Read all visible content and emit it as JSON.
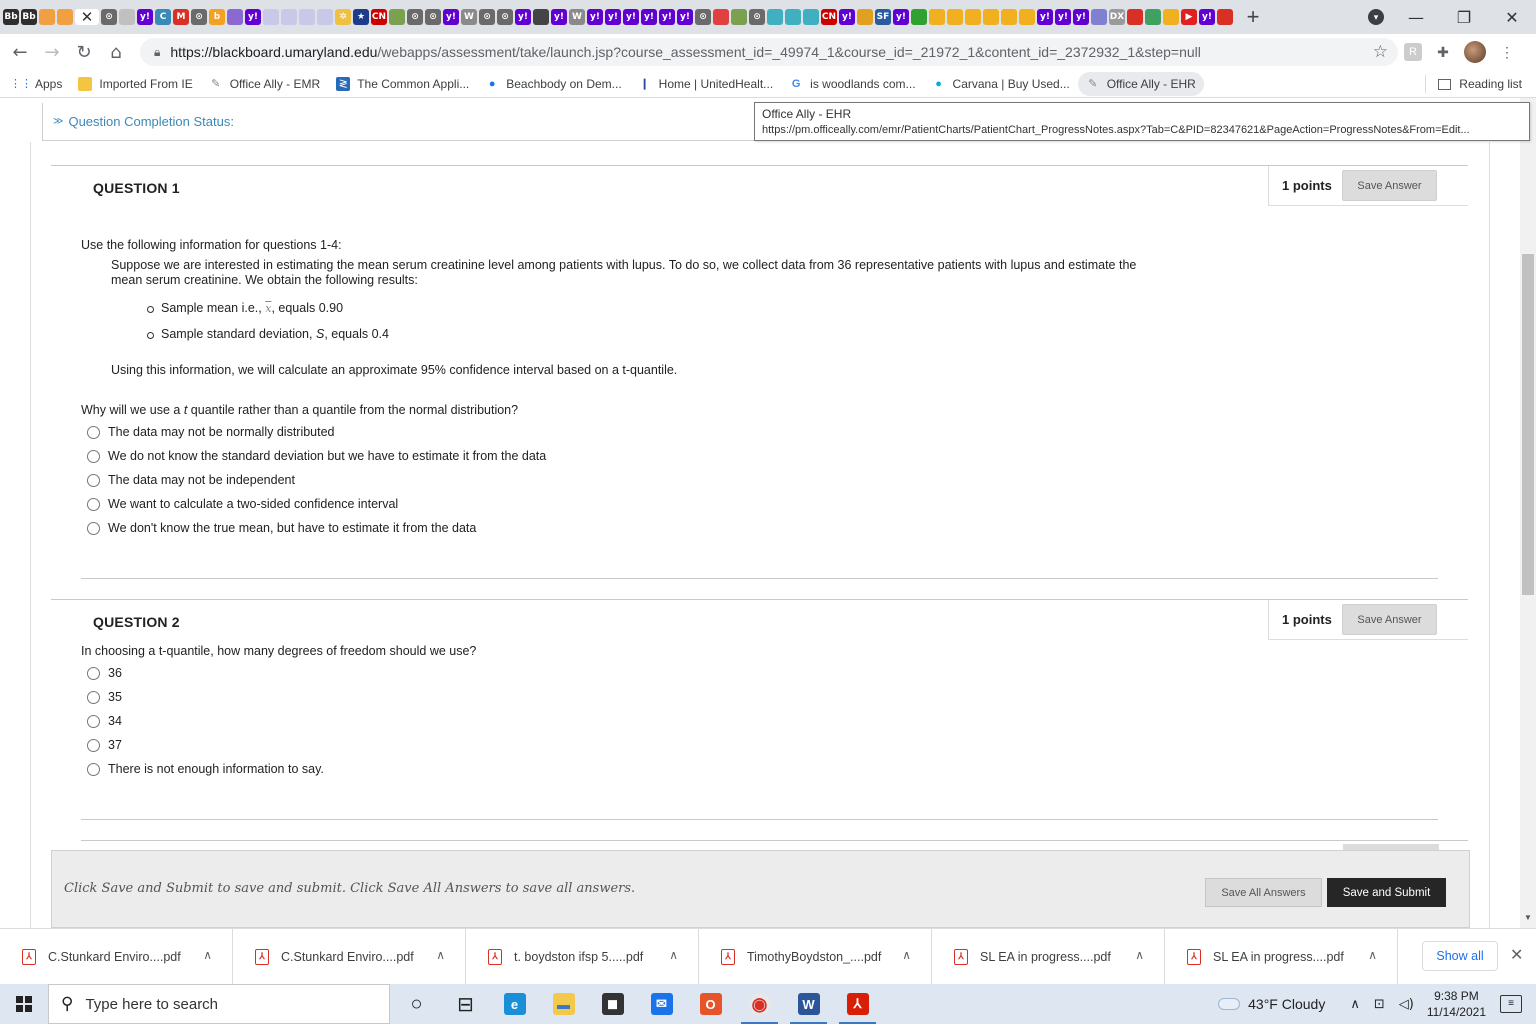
{
  "browser": {
    "url_host": "https://blackboard.umaryland.edu",
    "url_path": "/webapps/assessment/take/launch.jsp?course_assessment_id=_49974_1&course_id=_21972_1&content_id=_2372932_1&step=null",
    "new_tab_label": "+",
    "window_controls": {
      "minimize": "—",
      "restore": "❐",
      "close": "✕"
    },
    "tab_favicons": [
      {
        "label": "Bb",
        "color": "#2e2e2e"
      },
      {
        "label": "Bb",
        "color": "#2e2e2e"
      },
      {
        "label": "",
        "color": "#f0a040"
      },
      {
        "label": "",
        "color": "#f0a040"
      },
      {
        "label": "✕",
        "color": "#ffffff",
        "active": true
      },
      {
        "label": "⊙",
        "color": "#6a6a6a"
      },
      {
        "label": "",
        "color": "#c0c0c0"
      },
      {
        "label": "y!",
        "color": "#6001d2"
      },
      {
        "label": "C",
        "color": "#3a8ab8"
      },
      {
        "label": "M",
        "color": "#d93025"
      },
      {
        "label": "⊙",
        "color": "#6a6a6a"
      },
      {
        "label": "b",
        "color": "#f4a020"
      },
      {
        "label": "",
        "color": "#8a6ad0"
      },
      {
        "label": "y!",
        "color": "#6001d2"
      },
      {
        "label": "",
        "color": "#c8c8e8"
      },
      {
        "label": "",
        "color": "#c8c8e8"
      },
      {
        "label": "",
        "color": "#c8c8e8"
      },
      {
        "label": "",
        "color": "#c8c8e8"
      },
      {
        "label": "✲",
        "color": "#f0c040"
      },
      {
        "label": "★",
        "color": "#1f3b8c"
      },
      {
        "label": "CN",
        "color": "#cc0000"
      },
      {
        "label": "",
        "color": "#7aa050"
      },
      {
        "label": "⊙",
        "color": "#6a6a6a"
      },
      {
        "label": "⊙",
        "color": "#6a6a6a"
      },
      {
        "label": "y!",
        "color": "#6001d2"
      },
      {
        "label": "W",
        "color": "#8a8a8a"
      },
      {
        "label": "⊙",
        "color": "#6a6a6a"
      },
      {
        "label": "⊙",
        "color": "#6a6a6a"
      },
      {
        "label": "y!",
        "color": "#6001d2"
      },
      {
        "label": "",
        "color": "#444444"
      },
      {
        "label": "y!",
        "color": "#6001d2"
      },
      {
        "label": "W",
        "color": "#8a8a8a"
      },
      {
        "label": "y!",
        "color": "#6001d2"
      },
      {
        "label": "y!",
        "color": "#6001d2"
      },
      {
        "label": "y!",
        "color": "#6001d2"
      },
      {
        "label": "y!",
        "color": "#6001d2"
      },
      {
        "label": "y!",
        "color": "#6001d2"
      },
      {
        "label": "y!",
        "color": "#6001d2"
      },
      {
        "label": "⊙",
        "color": "#6a6a6a"
      },
      {
        "label": "",
        "color": "#e04040"
      },
      {
        "label": "",
        "color": "#7aa050"
      },
      {
        "label": "⊙",
        "color": "#6a6a6a"
      },
      {
        "label": "",
        "color": "#40b0c0"
      },
      {
        "label": "",
        "color": "#40b0c0"
      },
      {
        "label": "",
        "color": "#40b0c0"
      },
      {
        "label": "CN",
        "color": "#cc0000"
      },
      {
        "label": "y!",
        "color": "#6001d2"
      },
      {
        "label": "",
        "color": "#e0a020"
      },
      {
        "label": "SF",
        "color": "#2a5aa0"
      },
      {
        "label": "y!",
        "color": "#6001d2"
      },
      {
        "label": "",
        "color": "#30a030"
      },
      {
        "label": "",
        "color": "#f0b020"
      },
      {
        "label": "",
        "color": "#f0b020"
      },
      {
        "label": "",
        "color": "#f0b020"
      },
      {
        "label": "",
        "color": "#f0b020"
      },
      {
        "label": "",
        "color": "#f0b020"
      },
      {
        "label": "",
        "color": "#f0b020"
      },
      {
        "label": "y!",
        "color": "#6001d2"
      },
      {
        "label": "y!",
        "color": "#6001d2"
      },
      {
        "label": "y!",
        "color": "#6001d2"
      },
      {
        "label": "",
        "color": "#8080d0"
      },
      {
        "label": "DX",
        "color": "#9a9a9a"
      },
      {
        "label": "",
        "color": "#d93025"
      },
      {
        "label": "",
        "color": "#40a060"
      },
      {
        "label": "",
        "color": "#f0b020"
      },
      {
        "label": "▶",
        "color": "#e02020"
      },
      {
        "label": "y!",
        "color": "#6001d2"
      },
      {
        "label": "",
        "color": "#d93025"
      }
    ],
    "bookmarks": [
      {
        "label": "Apps",
        "icon": "apps-grid-icon",
        "icon_glyph": "⋮⋮"
      },
      {
        "label": "Imported From IE",
        "icon": "folder-icon",
        "icon_glyph": ""
      },
      {
        "label": "Office Ally - EMR",
        "icon": "office-ally-icon",
        "icon_glyph": "✎"
      },
      {
        "label": "The Common Appli...",
        "icon": "common-app-icon",
        "icon_glyph": "≷"
      },
      {
        "label": "Beachbody on Dem...",
        "icon": "beachbody-icon",
        "icon_glyph": "●"
      },
      {
        "label": "Home | UnitedHealt...",
        "icon": "unitedhealth-icon",
        "icon_glyph": "❙"
      },
      {
        "label": "is woodlands com...",
        "icon": "google-icon",
        "icon_glyph": "G"
      },
      {
        "label": "Carvana | Buy Used...",
        "icon": "carvana-icon",
        "icon_glyph": "●"
      },
      {
        "label": "Office Ally - EHR",
        "icon": "office-ally-icon",
        "icon_glyph": "✎"
      }
    ],
    "reading_list_label": "Reading list"
  },
  "tooltip": {
    "title": "Office Ally - EHR",
    "url": "https://pm.officeally.com/emr/PatientCharts/PatientChart_ProgressNotes.aspx?Tab=C&PID=82347621&PageAction=ProgressNotes&From=Edit..."
  },
  "assessment": {
    "completion_status_label": "Question Completion Status:",
    "questions": [
      {
        "title": "QUESTION 1",
        "points": "1 points",
        "save_label": "Save Answer",
        "intro": "Use the following information for questions 1-4:",
        "scenario": "Suppose we are interested in estimating the mean serum creatinine level among patients with lupus.  To do so, we collect data from 36 representative patients with lupus and estimate the mean serum creatinine.  We obtain the following results:",
        "bullet1_prefix": "Sample mean i.e.,",
        "bullet1_symbol": "x",
        "bullet1_suffix": ", equals 0.90",
        "bullet2_prefix": "Sample standard deviation,",
        "bullet2_symbol": "S",
        "bullet2_suffix": ", equals 0.4",
        "calc_note": "Using this information, we will calculate an approximate 95% confidence interval based on a t-quantile.",
        "prompt_prefix": "Why will we use a",
        "prompt_symbol": "t",
        "prompt_suffix": "quantile rather than a quantile from the normal distribution?",
        "options": [
          "The data may not be normally distributed",
          "We do not know the standard deviation but we have to estimate it from the data",
          "The data may not be independent",
          "We want to calculate a two-sided confidence interval",
          "We don't know the true mean, but have to estimate it from the data"
        ]
      },
      {
        "title": "QUESTION 2",
        "points": "1 points",
        "save_label": "Save Answer",
        "prompt": "In choosing a t-quantile, how many degrees of freedom should we use?",
        "options": [
          "36",
          "35",
          "34",
          "37",
          "There is not enough information to say."
        ]
      }
    ],
    "footer_message": "Click Save and Submit to save and submit. Click Save All Answers to save all answers.",
    "save_all_label": "Save All Answers",
    "submit_label": "Save and Submit"
  },
  "downloads": {
    "items": [
      "C.Stunkard Enviro....pdf",
      "C.Stunkard Enviro....pdf",
      "t. boydston ifsp 5.....pdf",
      "TimothyBoydston_....pdf",
      "SL EA in progress....pdf",
      "SL EA in progress....pdf"
    ],
    "show_all_label": "Show all",
    "close_label": "✕"
  },
  "taskbar": {
    "search_placeholder": "Type here to search",
    "weather": "43°F  Cloudy",
    "time": "9:38 PM",
    "date": "11/14/2021",
    "apps": [
      {
        "name": "cortana-icon",
        "glyph": "○",
        "bg": "transparent",
        "fg": "#222",
        "running": false
      },
      {
        "name": "task-view-icon",
        "glyph": "⊟",
        "bg": "transparent",
        "fg": "#222",
        "running": false
      },
      {
        "name": "edge-icon",
        "glyph": "e",
        "bg": "#1a8fd8",
        "fg": "#fff",
        "running": false
      },
      {
        "name": "file-explorer-icon",
        "glyph": "▬",
        "bg": "#f2c94c",
        "fg": "#3b78c4",
        "running": false
      },
      {
        "name": "store-icon",
        "glyph": "◼",
        "bg": "#333333",
        "fg": "#fff",
        "running": false
      },
      {
        "name": "mail-icon",
        "glyph": "✉",
        "bg": "#1a73e8",
        "fg": "#fff",
        "running": false
      },
      {
        "name": "office-icon",
        "glyph": "O",
        "bg": "#e8542a",
        "fg": "#fff",
        "running": false
      },
      {
        "name": "chrome-icon",
        "glyph": "◉",
        "bg": "#e8e8e8",
        "fg": "#d93025",
        "running": true
      },
      {
        "name": "word-icon",
        "glyph": "W",
        "bg": "#2b579a",
        "fg": "#fff",
        "running": true
      },
      {
        "name": "acrobat-icon",
        "glyph": "⅄",
        "bg": "#d81e05",
        "fg": "#fff",
        "running": true
      }
    ]
  },
  "colors": {
    "link_blue": "#3a8ab8",
    "submit_bg": "#262626",
    "download_show_all": "#1a73e8"
  }
}
